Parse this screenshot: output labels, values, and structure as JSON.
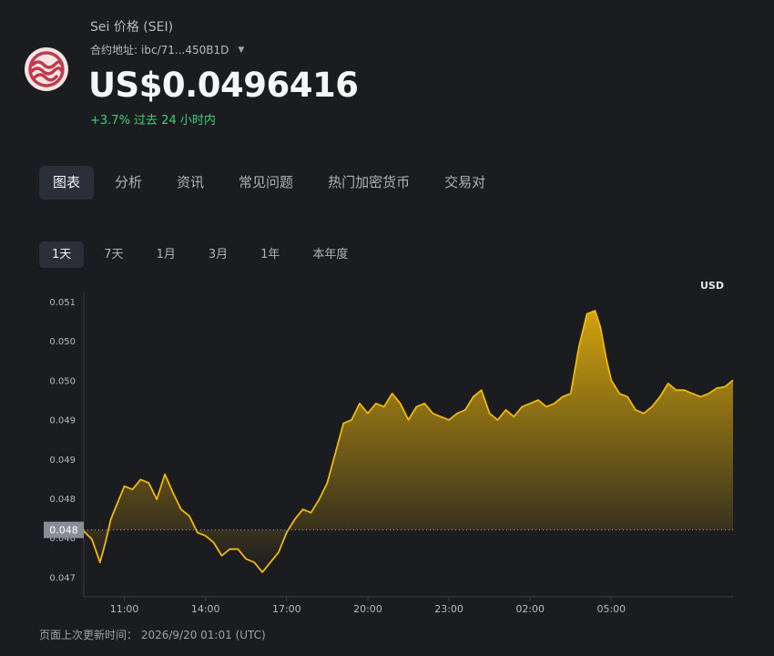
{
  "header": {
    "coin_name": "Sei 价格 (SEI)",
    "contract_label": "合约地址:",
    "contract_value": "ibc/71...450B1D",
    "price": "US$0.0496416",
    "change": "+3.7% 过去 24 小时内",
    "logo_icon": "sei-logo-icon",
    "colors": {
      "logo_bg": "#f4e4e4",
      "logo_fg": "#c03a4a",
      "positive": "#3fcf7a"
    }
  },
  "tabs": [
    {
      "label": "图表",
      "active": true
    },
    {
      "label": "分析",
      "active": false
    },
    {
      "label": "资讯",
      "active": false
    },
    {
      "label": "常见问题",
      "active": false
    },
    {
      "label": "热门加密货币",
      "active": false
    },
    {
      "label": "交易对",
      "active": false
    }
  ],
  "ranges": [
    {
      "label": "1天",
      "active": true
    },
    {
      "label": "7天",
      "active": false
    },
    {
      "label": "1月",
      "active": false
    },
    {
      "label": "3月",
      "active": false
    },
    {
      "label": "1年",
      "active": false
    },
    {
      "label": "本年度",
      "active": false
    }
  ],
  "chart_data": {
    "type": "area",
    "currency_label": "USD",
    "line_color": "#f0b90b",
    "current_label": "0.048",
    "baseline": 0.04784,
    "ylim": [
      0.04683,
      0.05137
    ],
    "y_ticks": [
      {
        "label": "0.051",
        "value": 0.0512
      },
      {
        "label": "0.050",
        "value": 0.0502
      },
      {
        "label": "0.050",
        "value": 0.0492
      },
      {
        "label": "0.049",
        "value": 0.0482
      },
      {
        "label": "0.049",
        "value": 0.0472
      },
      {
        "label": "0.048",
        "value": 0.0462
      },
      {
        "label": "0.048",
        "value": 0.0452
      },
      {
        "label": "0.047",
        "value": 0.0442
      }
    ],
    "xlim": [
      9.5,
      33.5
    ],
    "x_ticks": [
      {
        "label": "11:00",
        "value": 11
      },
      {
        "label": "14:00",
        "value": 14
      },
      {
        "label": "17:00",
        "value": 17
      },
      {
        "label": "20:00",
        "value": 20
      },
      {
        "label": "23:00",
        "value": 23
      },
      {
        "label": "02:00",
        "value": 26
      },
      {
        "label": "05:00",
        "value": 29
      }
    ],
    "x": [
      9.5,
      9.8,
      10.1,
      10.3,
      10.5,
      10.8,
      11.0,
      11.3,
      11.6,
      11.9,
      12.2,
      12.5,
      12.8,
      13.1,
      13.4,
      13.7,
      14.0,
      14.3,
      14.6,
      14.9,
      15.2,
      15.5,
      15.8,
      16.1,
      16.4,
      16.7,
      17.0,
      17.3,
      17.6,
      17.9,
      18.2,
      18.5,
      18.8,
      19.1,
      19.4,
      19.7,
      20.0,
      20.3,
      20.6,
      20.9,
      21.2,
      21.5,
      21.8,
      22.1,
      22.4,
      22.7,
      23.0,
      23.3,
      23.6,
      23.9,
      24.2,
      24.5,
      24.8,
      25.1,
      25.4,
      25.7,
      26.0,
      26.3,
      26.6,
      26.9,
      27.2,
      27.5,
      27.8,
      28.1,
      28.4,
      28.6,
      28.8,
      29.0,
      29.3,
      29.6,
      29.9,
      30.2,
      30.5,
      30.8,
      31.1,
      31.4,
      31.7,
      32.0,
      32.3,
      32.6,
      32.9,
      33.2,
      33.5
    ],
    "values": [
      0.04782,
      0.0477,
      0.04735,
      0.04765,
      0.048,
      0.0483,
      0.0485,
      0.04845,
      0.0486,
      0.04855,
      0.0483,
      0.04868,
      0.0484,
      0.04815,
      0.04805,
      0.0478,
      0.04775,
      0.04765,
      0.04745,
      0.04755,
      0.04755,
      0.0474,
      0.04735,
      0.0472,
      0.04735,
      0.0475,
      0.0478,
      0.048,
      0.04815,
      0.0481,
      0.0483,
      0.04855,
      0.049,
      0.04945,
      0.0495,
      0.04975,
      0.0496,
      0.04975,
      0.0497,
      0.0499,
      0.04975,
      0.0495,
      0.0497,
      0.04975,
      0.0496,
      0.04955,
      0.0495,
      0.0496,
      0.04965,
      0.04985,
      0.04995,
      0.0496,
      0.0495,
      0.04965,
      0.04955,
      0.0497,
      0.04975,
      0.0498,
      0.0497,
      0.04975,
      0.04985,
      0.0499,
      0.0506,
      0.0511,
      0.05115,
      0.0509,
      0.05045,
      0.0501,
      0.0499,
      0.04985,
      0.04965,
      0.0496,
      0.0497,
      0.04985,
      0.05005,
      0.04995,
      0.04995,
      0.0499,
      0.04985,
      0.0499,
      0.04998,
      0.05,
      0.0501
    ]
  },
  "footer": {
    "updated": "页面上次更新时间： 2026/9/20 01:01 (UTC)"
  }
}
